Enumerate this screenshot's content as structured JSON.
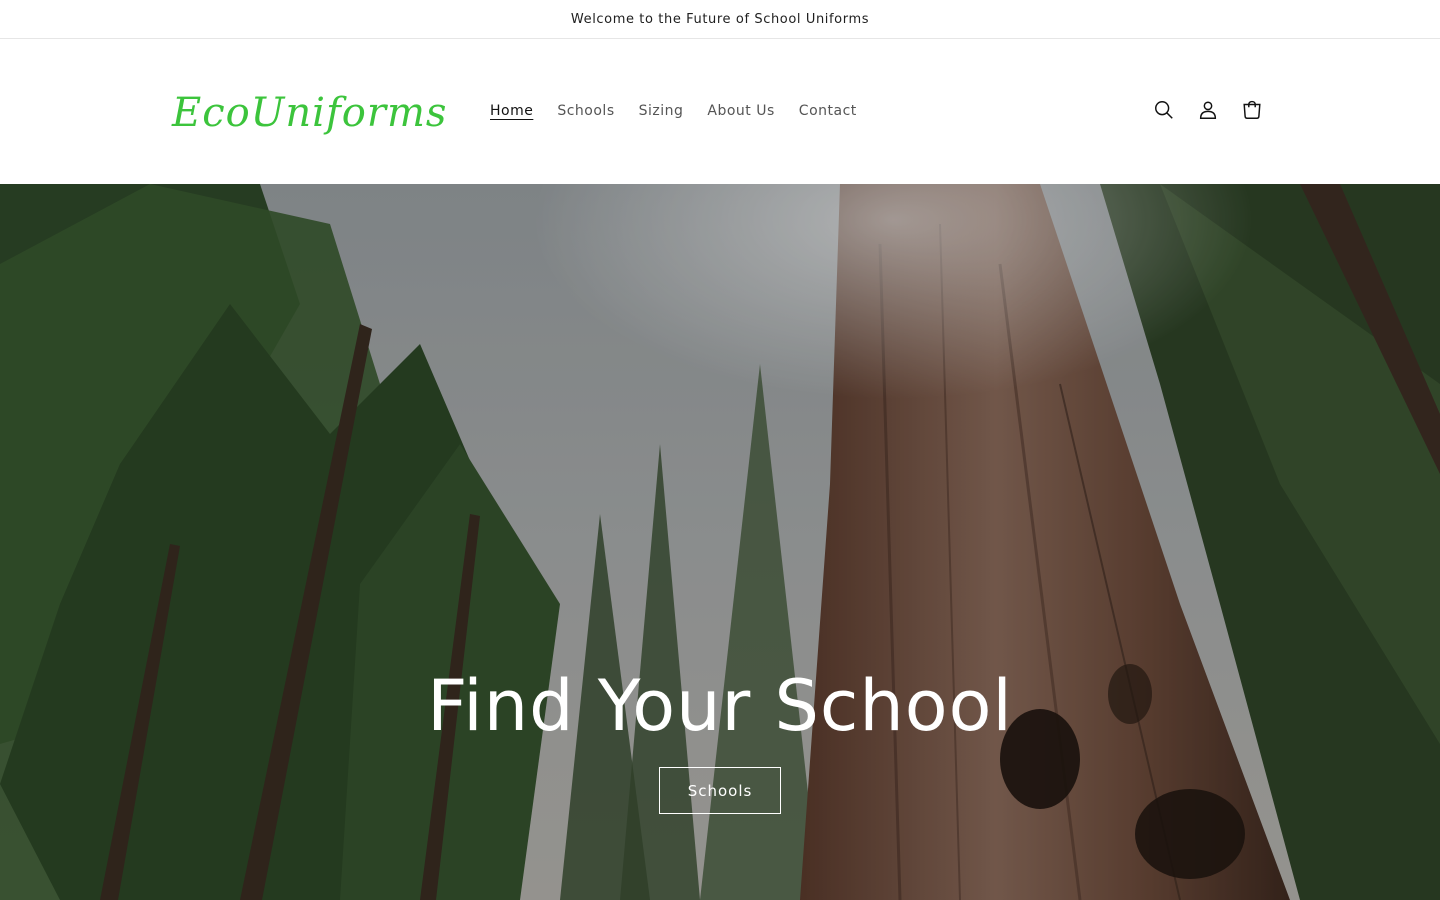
{
  "announcement": {
    "text": "Welcome to the Future of School Uniforms"
  },
  "header": {
    "logo": "EcoUniforms",
    "nav": [
      {
        "label": "Home",
        "active": true
      },
      {
        "label": "Schools",
        "active": false
      },
      {
        "label": "Sizing",
        "active": false
      },
      {
        "label": "About Us",
        "active": false
      },
      {
        "label": "Contact",
        "active": false
      }
    ],
    "icons": [
      "search-icon",
      "account-icon",
      "cart-icon"
    ]
  },
  "hero": {
    "title": "Find Your School",
    "button_label": "Schools"
  },
  "colors": {
    "logo": "#3cc43c",
    "text": "#121212",
    "nav_text": "#555555",
    "hero_text": "#ffffff"
  }
}
